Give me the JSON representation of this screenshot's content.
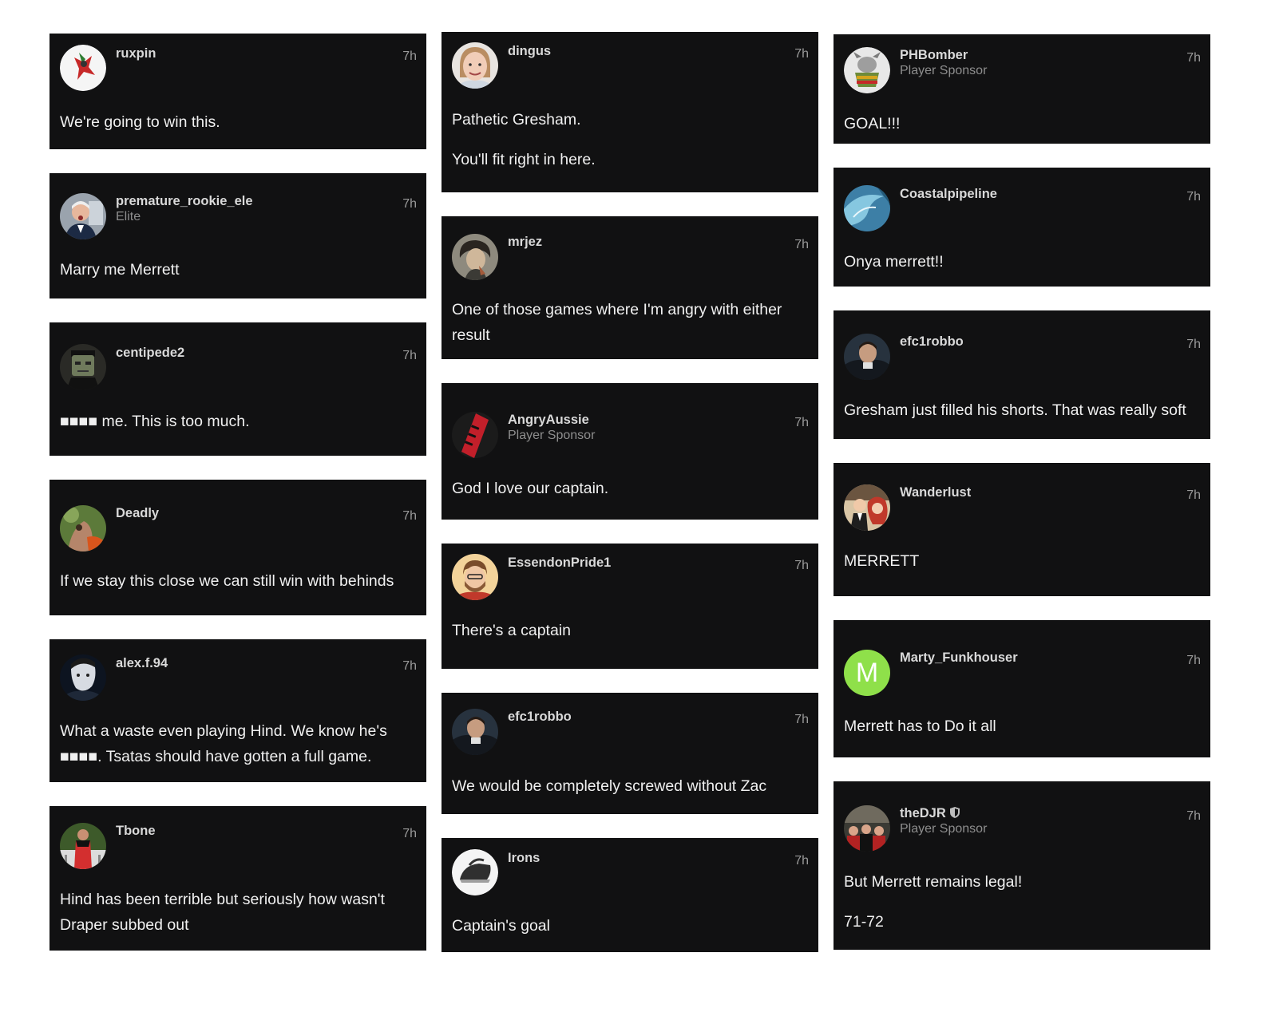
{
  "comments": [
    {
      "user": "ruxpin",
      "role": "",
      "time": "7h",
      "lines": [
        "We're going to win this."
      ]
    },
    {
      "user": "premature_rookie_ele",
      "role": "Elite",
      "time": "7h",
      "lines": [
        "Marry me Merrett"
      ]
    },
    {
      "user": "centipede2",
      "role": "",
      "time": "7h",
      "lines": [
        "■■■■ me. This is too much."
      ]
    },
    {
      "user": "Deadly",
      "role": "",
      "time": "7h",
      "lines": [
        "If we stay this close we can still win with behinds"
      ]
    },
    {
      "user": "alex.f.94",
      "role": "",
      "time": "7h",
      "lines": [
        "What a waste even playing Hind. We know he's ■■■■. Tsatas should have gotten a full game."
      ]
    },
    {
      "user": "Tbone",
      "role": "",
      "time": "7h",
      "lines": [
        "Hind has been terrible but seriously how wasn't Draper subbed out"
      ]
    },
    {
      "user": "dingus",
      "role": "",
      "time": "7h",
      "lines": [
        "Pathetic Gresham.",
        "You'll fit right in here."
      ]
    },
    {
      "user": "mrjez",
      "role": "",
      "time": "7h",
      "lines": [
        "One of those games where I'm angry with either result"
      ]
    },
    {
      "user": "AngryAussie",
      "role": "Player Sponsor",
      "time": "7h",
      "lines": [
        "God I love our captain."
      ]
    },
    {
      "user": "EssendonPride1",
      "role": "",
      "time": "7h",
      "lines": [
        "There's a captain"
      ]
    },
    {
      "user": "efc1robbo",
      "role": "",
      "time": "7h",
      "lines": [
        "We would be completely screwed without Zac"
      ]
    },
    {
      "user": "Irons",
      "role": "",
      "time": "7h",
      "lines": [
        "Captain's goal"
      ]
    },
    {
      "user": "PHBomber",
      "role": "Player Sponsor",
      "time": "7h",
      "lines": [
        "GOAL!!!"
      ]
    },
    {
      "user": "Coastalpipeline",
      "role": "",
      "time": "7h",
      "lines": [
        "Onya merrett!!"
      ]
    },
    {
      "user": "efc1robbo",
      "role": "",
      "time": "7h",
      "lines": [
        "Gresham just filled his shorts. That was really soft"
      ]
    },
    {
      "user": "Wanderlust",
      "role": "",
      "time": "7h",
      "lines": [
        "MERRETT"
      ]
    },
    {
      "user": "Marty_Funkhouser",
      "role": "",
      "time": "7h",
      "avatar_letter": "M",
      "lines": [
        "Merrett has to Do it all"
      ]
    },
    {
      "user": "theDJR",
      "role": "Player Sponsor",
      "time": "7h",
      "lines": [
        "But Merrett remains legal!",
        "71-72"
      ]
    }
  ],
  "colors": {
    "card_bg": "#111112",
    "username": "#d9d9d9",
    "role": "#8e8e8e",
    "time": "#9a9a9a",
    "avatar_letter_bg": "#8fe04a"
  }
}
